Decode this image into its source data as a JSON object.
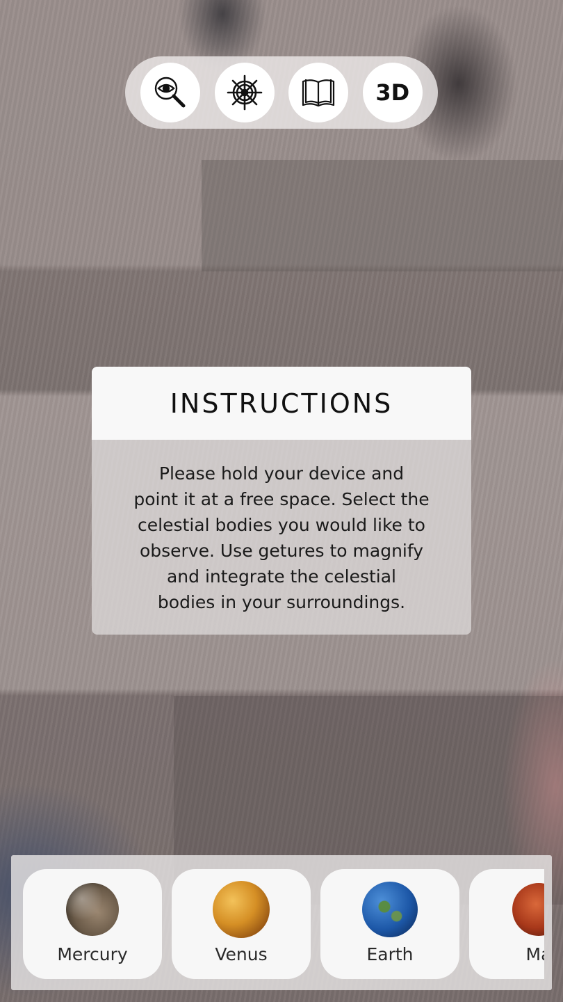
{
  "toolbar": {
    "buttons": [
      {
        "icon": "magnifier-eye-icon"
      },
      {
        "icon": "ship-wheel-icon"
      },
      {
        "icon": "open-book-icon"
      },
      {
        "label": "3D"
      }
    ]
  },
  "instructions": {
    "title": "INSTRUCTIONS",
    "lines": [
      "Please hold your device and",
      "point it at a free space. Select the",
      "celestial bodies you would like to",
      "observe. Use getures to magnify",
      "and integrate the celestial",
      "bodies in your surroundings."
    ]
  },
  "planets": [
    {
      "name": "Mercury"
    },
    {
      "name": "Venus"
    },
    {
      "name": "Earth"
    },
    {
      "name": "Ma"
    }
  ]
}
